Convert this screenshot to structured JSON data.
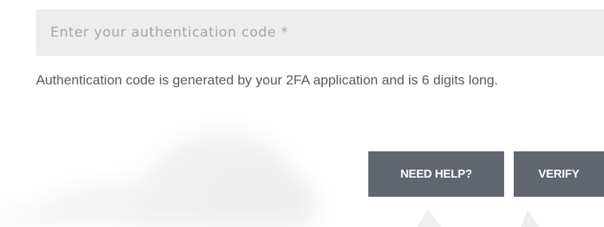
{
  "auth_form": {
    "code_input": {
      "placeholder": "Enter your authentication code *",
      "value": ""
    },
    "help_text": "Authentication code is generated by your 2FA application and is 6 digits long.",
    "buttons": {
      "need_help_label": "NEED HELP?",
      "verify_label": "VERIFY"
    }
  },
  "colors": {
    "input_background": "#ededed",
    "placeholder_text": "#a4a4a4",
    "body_text": "#555a60",
    "button_background": "#5f6670",
    "button_text": "#ffffff"
  }
}
